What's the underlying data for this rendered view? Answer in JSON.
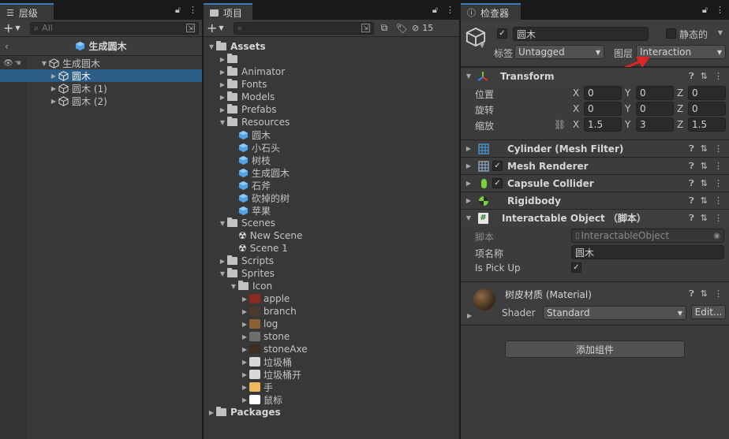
{
  "hierarchy": {
    "tab": "层级",
    "search_placeholder": "All",
    "breadcrumb": "生成圆木",
    "root": "生成圆木",
    "children": [
      "圆木",
      "圆木 (1)",
      "圆木 (2)"
    ]
  },
  "project": {
    "tab": "项目",
    "hidden_count": "15",
    "tree": [
      {
        "label": "Assets",
        "kind": "folder",
        "depth": 0,
        "open": true,
        "bold": true
      },
      {
        "label": "",
        "kind": "folder",
        "depth": 1,
        "open": false
      },
      {
        "label": "Animator",
        "kind": "folder",
        "depth": 1,
        "open": false
      },
      {
        "label": "Fonts",
        "kind": "folder",
        "depth": 1,
        "open": false
      },
      {
        "label": "Models",
        "kind": "folder",
        "depth": 1,
        "open": false
      },
      {
        "label": "Prefabs",
        "kind": "folder",
        "depth": 1,
        "open": false
      },
      {
        "label": "Resources",
        "kind": "folder",
        "depth": 1,
        "open": true
      },
      {
        "label": "圆木",
        "kind": "prefab",
        "depth": 2
      },
      {
        "label": "小石头",
        "kind": "prefab",
        "depth": 2
      },
      {
        "label": "树枝",
        "kind": "prefab",
        "depth": 2
      },
      {
        "label": "生成圆木",
        "kind": "prefab",
        "depth": 2
      },
      {
        "label": "石斧",
        "kind": "prefab",
        "depth": 2
      },
      {
        "label": "砍掉的树",
        "kind": "prefab",
        "depth": 2
      },
      {
        "label": "苹果",
        "kind": "prefab",
        "depth": 2
      },
      {
        "label": "Scenes",
        "kind": "folder",
        "depth": 1,
        "open": true
      },
      {
        "label": "New Scene",
        "kind": "scene",
        "depth": 2
      },
      {
        "label": "Scene 1",
        "kind": "scene",
        "depth": 2
      },
      {
        "label": "Scripts",
        "kind": "folder",
        "depth": 1,
        "open": false
      },
      {
        "label": "Sprites",
        "kind": "folder",
        "depth": 1,
        "open": true
      },
      {
        "label": "Icon",
        "kind": "folder",
        "depth": 2,
        "open": true
      },
      {
        "label": "apple",
        "kind": "sprite",
        "depth": 3,
        "color": "#8b2a24"
      },
      {
        "label": "branch",
        "kind": "sprite",
        "depth": 3,
        "color": "#4a3a2c"
      },
      {
        "label": "log",
        "kind": "sprite",
        "depth": 3,
        "color": "#8a6234"
      },
      {
        "label": "stone",
        "kind": "sprite",
        "depth": 3,
        "color": "#6e6e6e"
      },
      {
        "label": "stoneAxe",
        "kind": "sprite",
        "depth": 3,
        "color": "#3e2e22"
      },
      {
        "label": "垃圾桶",
        "kind": "sprite",
        "depth": 3,
        "color": "#d8d8d8"
      },
      {
        "label": "垃圾桶开",
        "kind": "sprite",
        "depth": 3,
        "color": "#d8d8d8"
      },
      {
        "label": "手",
        "kind": "sprite",
        "depth": 3,
        "color": "#f0b860"
      },
      {
        "label": "鼠标",
        "kind": "sprite",
        "depth": 3,
        "color": "#ffffff"
      },
      {
        "label": "Packages",
        "kind": "folder",
        "depth": 0,
        "open": false,
        "bold": true
      }
    ]
  },
  "inspector": {
    "tab": "检查器",
    "object_name": "圆木",
    "static_label": "静态的",
    "tag_label": "标签",
    "tag_value": "Untagged",
    "layer_label": "图层",
    "layer_value": "Interaction",
    "transform": {
      "title": "Transform",
      "position_label": "位置",
      "rotation_label": "旋转",
      "scale_label": "缩放",
      "position": [
        "0",
        "0",
        "0"
      ],
      "rotation": [
        "0",
        "0",
        "0"
      ],
      "scale": [
        "1.5",
        "3",
        "1.5"
      ],
      "axes": [
        "X",
        "Y",
        "Z"
      ]
    },
    "components": [
      {
        "name": "Cylinder (Mesh Filter)",
        "checkbox": false,
        "icon": "mesh-filter-icon"
      },
      {
        "name": "Mesh Renderer",
        "checkbox": true,
        "icon": "mesh-renderer-icon"
      },
      {
        "name": "Capsule Collider",
        "checkbox": true,
        "icon": "capsule-collider-icon"
      },
      {
        "name": "Rigidbody",
        "checkbox": false,
        "icon": "rigidbody-icon"
      }
    ],
    "script_component": {
      "title": "Interactable Object （脚本）",
      "script_label": "脚本",
      "script_value": "InteractableObject",
      "item_name_label": "项名称",
      "item_name_value": "圆木",
      "pickup_label": "Is Pick Up"
    },
    "material": {
      "title": "树皮材质 (Material)",
      "shader_label": "Shader",
      "shader_value": "Standard",
      "edit_label": "Edit..."
    },
    "add_component_label": "添加组件"
  }
}
